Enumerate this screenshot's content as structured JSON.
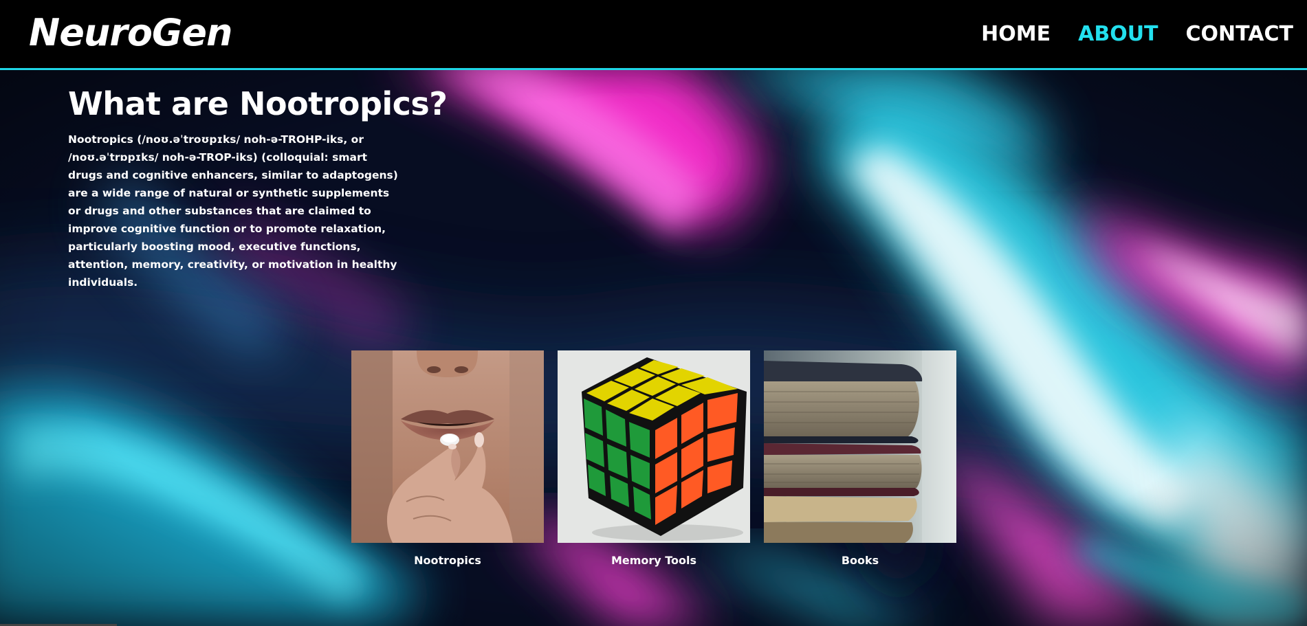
{
  "header": {
    "logo": "NeuroGen",
    "nav": [
      {
        "label": "HOME",
        "active": false
      },
      {
        "label": "ABOUT",
        "active": true
      },
      {
        "label": "CONTACT",
        "active": false
      }
    ]
  },
  "intro": {
    "title": "What are Nootropics?",
    "body": "Nootropics (/noʊ.əˈtroʊpɪks/ noh-ə-TROHP-iks, or /noʊ.əˈtrɒpɪks/ noh-ə-TROP-iks) (colloquial: smart drugs and cognitive enhancers, similar to adaptogens) are a wide range of natural or synthetic supplements or drugs and other substances that are claimed to improve cognitive function or to promote relaxation, particularly boosting mood, executive functions, attention, memory, creativity, or motivation in healthy individuals."
  },
  "cards": [
    {
      "caption": "Nootropics",
      "image": "woman-taking-pill-photo"
    },
    {
      "caption": "Memory Tools",
      "image": "rubiks-cube-photo"
    },
    {
      "caption": "Books",
      "image": "stacked-books-photo"
    }
  ],
  "colors": {
    "accent": "#23e0ee",
    "header_bg": "#000000",
    "header_border": "#1fd6e6",
    "text": "#ffffff",
    "bg_pink": "#ff2fd0",
    "bg_cyan": "#2fd8f0"
  }
}
